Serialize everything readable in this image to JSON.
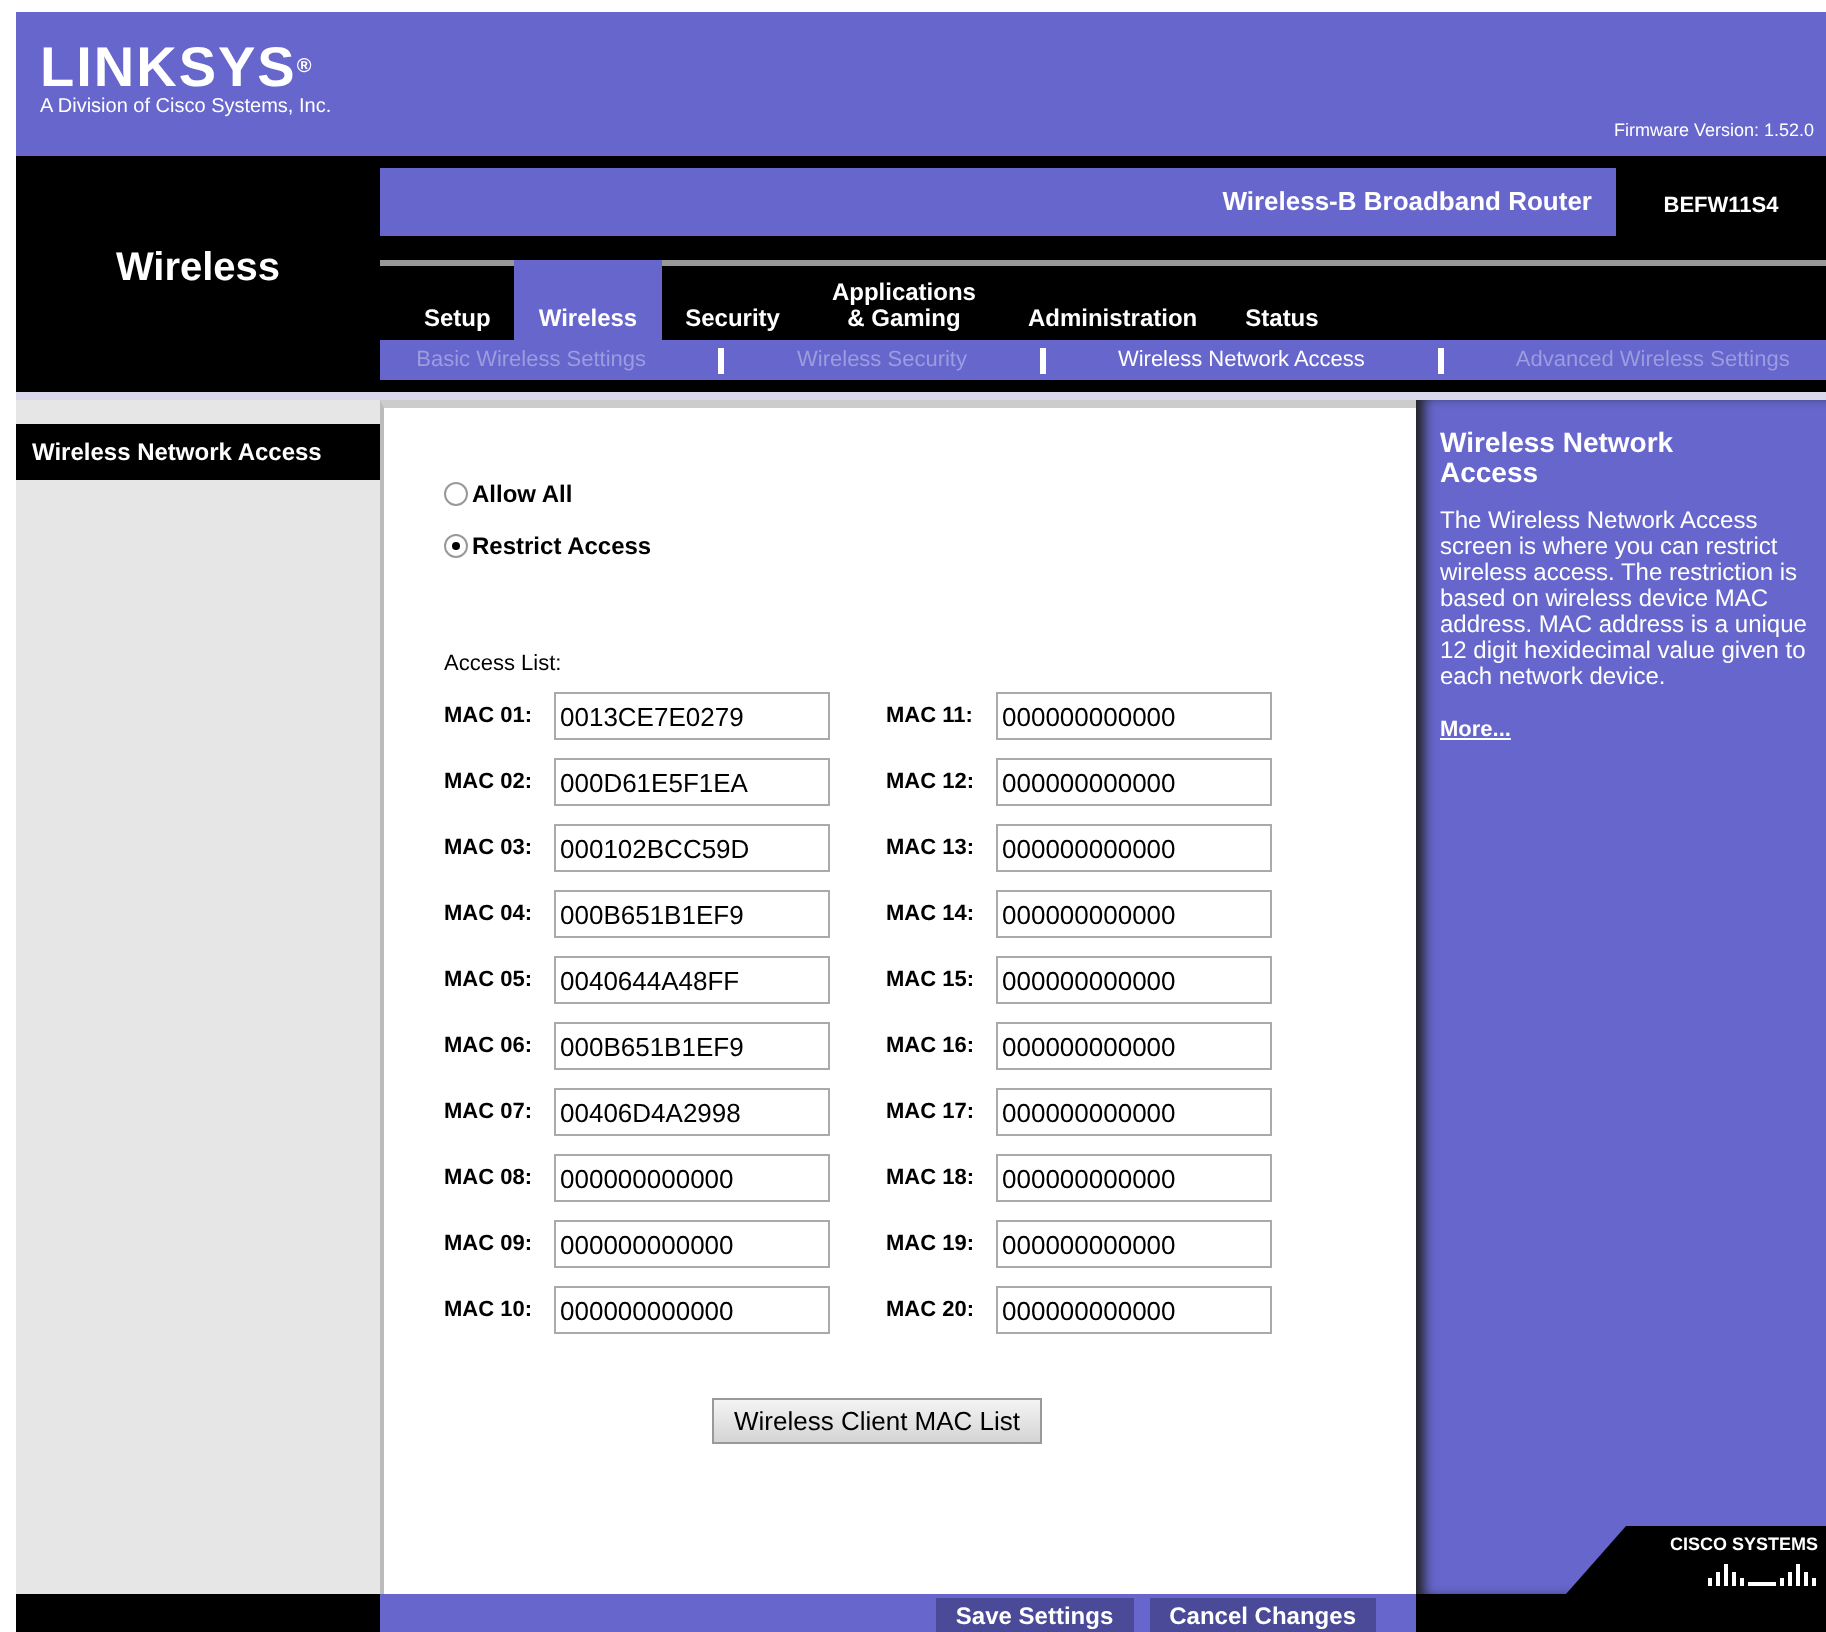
{
  "header": {
    "logo": "LINKSYS",
    "logo_mark": "®",
    "tagline": "A Division of Cisco Systems, Inc.",
    "firmware": "Firmware Version: 1.52.0"
  },
  "section_title": "Wireless",
  "product": {
    "name": "Wireless-B Broadband Router",
    "model": "BEFW11S4"
  },
  "tabs": [
    {
      "label": "Setup",
      "selected": false
    },
    {
      "label": "Wireless",
      "selected": true
    },
    {
      "label": "Security",
      "selected": false
    },
    {
      "label": "Applications & Gaming",
      "selected": false
    },
    {
      "label": "Administration",
      "selected": false
    },
    {
      "label": "Status",
      "selected": false
    }
  ],
  "subtabs": [
    {
      "label": "Basic Wireless Settings",
      "selected": false
    },
    {
      "label": "Wireless Security",
      "selected": false
    },
    {
      "label": "Wireless Network Access",
      "selected": true
    },
    {
      "label": "Advanced Wireless Settings",
      "selected": false
    }
  ],
  "sidebar": {
    "title": "Wireless Network Access"
  },
  "access_mode": [
    {
      "label": "Allow All",
      "selected": false
    },
    {
      "label": "Restrict Access",
      "selected": true
    }
  ],
  "access_list": {
    "label": "Access List:",
    "entries": [
      {
        "label": "MAC 01:",
        "value": "0013CE7E0279"
      },
      {
        "label": "MAC 02:",
        "value": "000D61E5F1EA"
      },
      {
        "label": "MAC 03:",
        "value": "000102BCC59D"
      },
      {
        "label": "MAC 04:",
        "value": "000B651B1EF9"
      },
      {
        "label": "MAC 05:",
        "value": "0040644A48FF"
      },
      {
        "label": "MAC 06:",
        "value": "000B651B1EF9"
      },
      {
        "label": "MAC 07:",
        "value": "00406D4A2998"
      },
      {
        "label": "MAC 08:",
        "value": "000000000000"
      },
      {
        "label": "MAC 09:",
        "value": "000000000000"
      },
      {
        "label": "MAC 10:",
        "value": "000000000000"
      },
      {
        "label": "MAC 11:",
        "value": "000000000000"
      },
      {
        "label": "MAC 12:",
        "value": "000000000000"
      },
      {
        "label": "MAC 13:",
        "value": "000000000000"
      },
      {
        "label": "MAC 14:",
        "value": "000000000000"
      },
      {
        "label": "MAC 15:",
        "value": "000000000000"
      },
      {
        "label": "MAC 16:",
        "value": "000000000000"
      },
      {
        "label": "MAC 17:",
        "value": "000000000000"
      },
      {
        "label": "MAC 18:",
        "value": "000000000000"
      },
      {
        "label": "MAC 19:",
        "value": "000000000000"
      },
      {
        "label": "MAC 20:",
        "value": "000000000000"
      }
    ]
  },
  "client_list_button": "Wireless Client MAC List",
  "help": {
    "title": "Wireless Network Access",
    "text": "The Wireless Network Access screen is where you can restrict wireless access. The restriction is based on wireless device MAC address. MAC address is a unique 12 digit hexidecimal value given to each network device.",
    "more": "More..."
  },
  "footer": {
    "buttons": [
      "Save Settings",
      "Cancel Changes"
    ],
    "brand": "CISCO SYSTEMS"
  }
}
